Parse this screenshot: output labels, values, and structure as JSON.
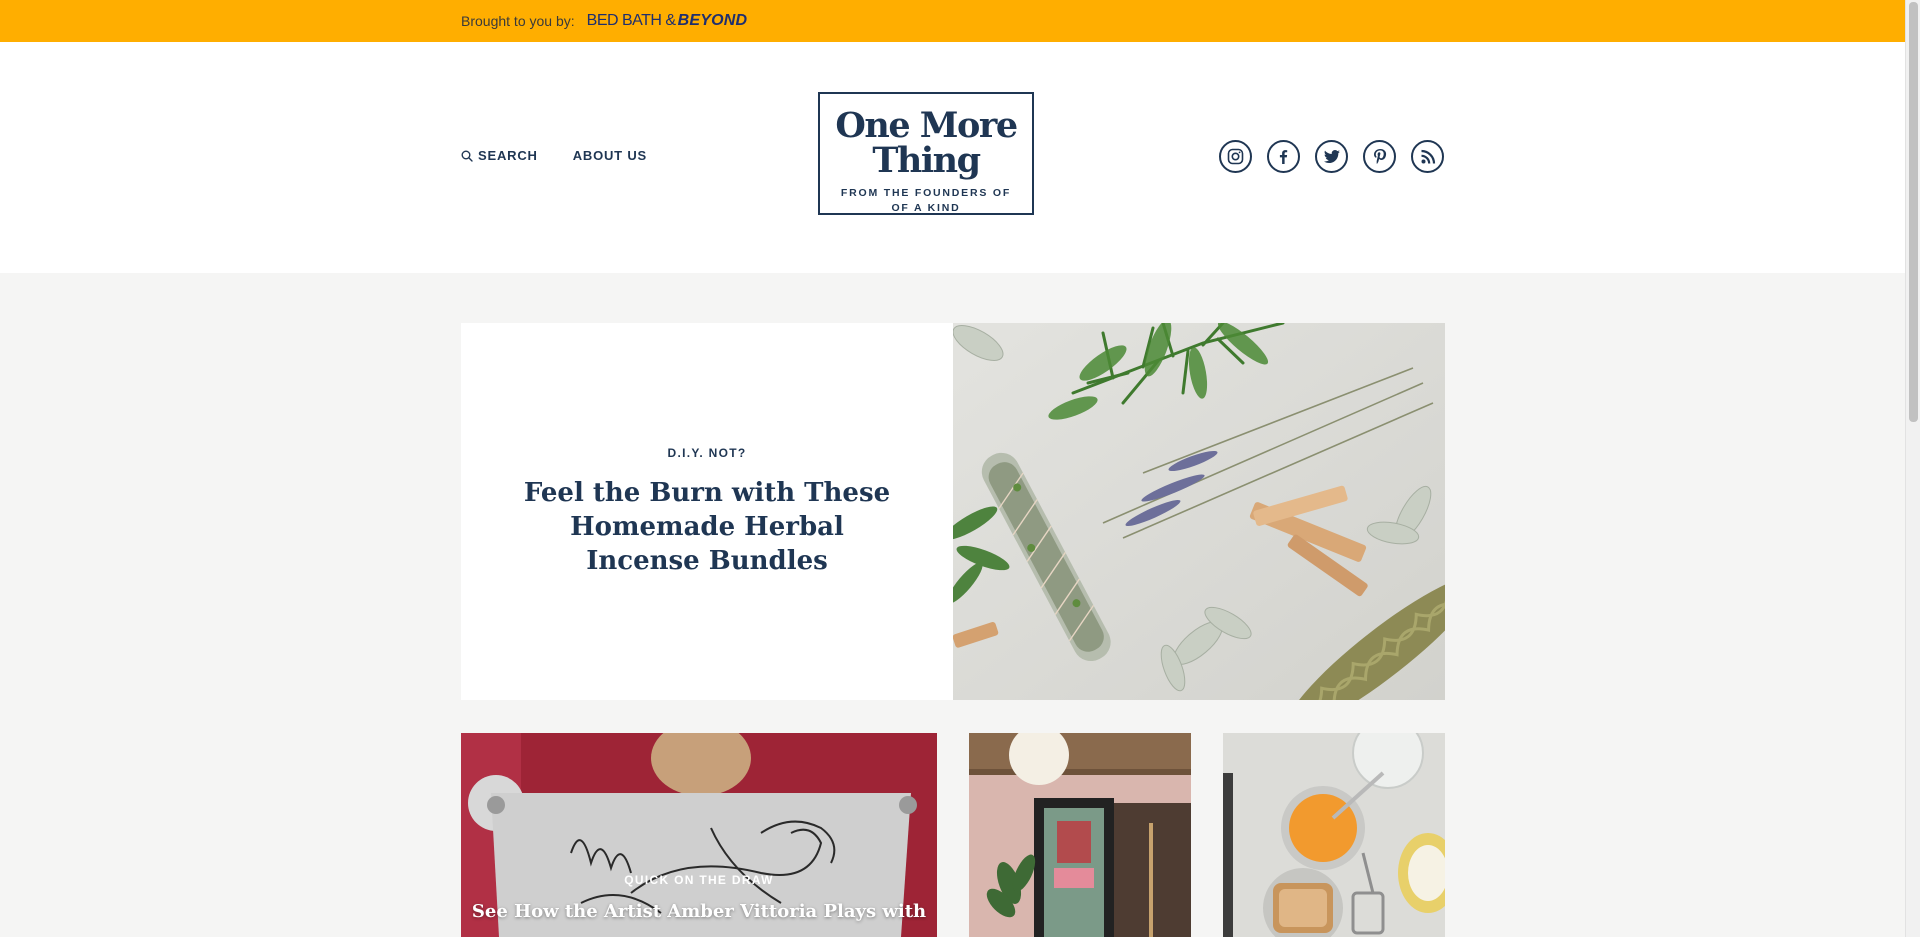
{
  "sponsor": {
    "label": "Brought to you by:",
    "brand_light": "BED BATH &",
    "brand_bold": "BEYOND"
  },
  "header": {
    "nav": {
      "search": "SEARCH",
      "about": "ABOUT US"
    },
    "logo": {
      "title_line1": "One More",
      "title_line2": "Thing",
      "subtitle_line1": "FROM THE FOUNDERS OF",
      "subtitle_line2": "OF A KIND"
    },
    "social_icons": [
      "instagram-icon",
      "facebook-icon",
      "twitter-icon",
      "pinterest-icon",
      "rss-icon"
    ]
  },
  "feature": {
    "kicker": "D.I.Y. NOT?",
    "title": "Feel the Burn with These Homemade Herbal Incense Bundles"
  },
  "cards": [
    {
      "kicker": "QUICK ON THE DRAW",
      "title": "See How the Artist Amber Vittoria Plays with"
    }
  ],
  "colors": {
    "sponsor_bar": "#ffae00",
    "brand_navy": "#1f3653",
    "page_background": "#f5f5f4"
  }
}
